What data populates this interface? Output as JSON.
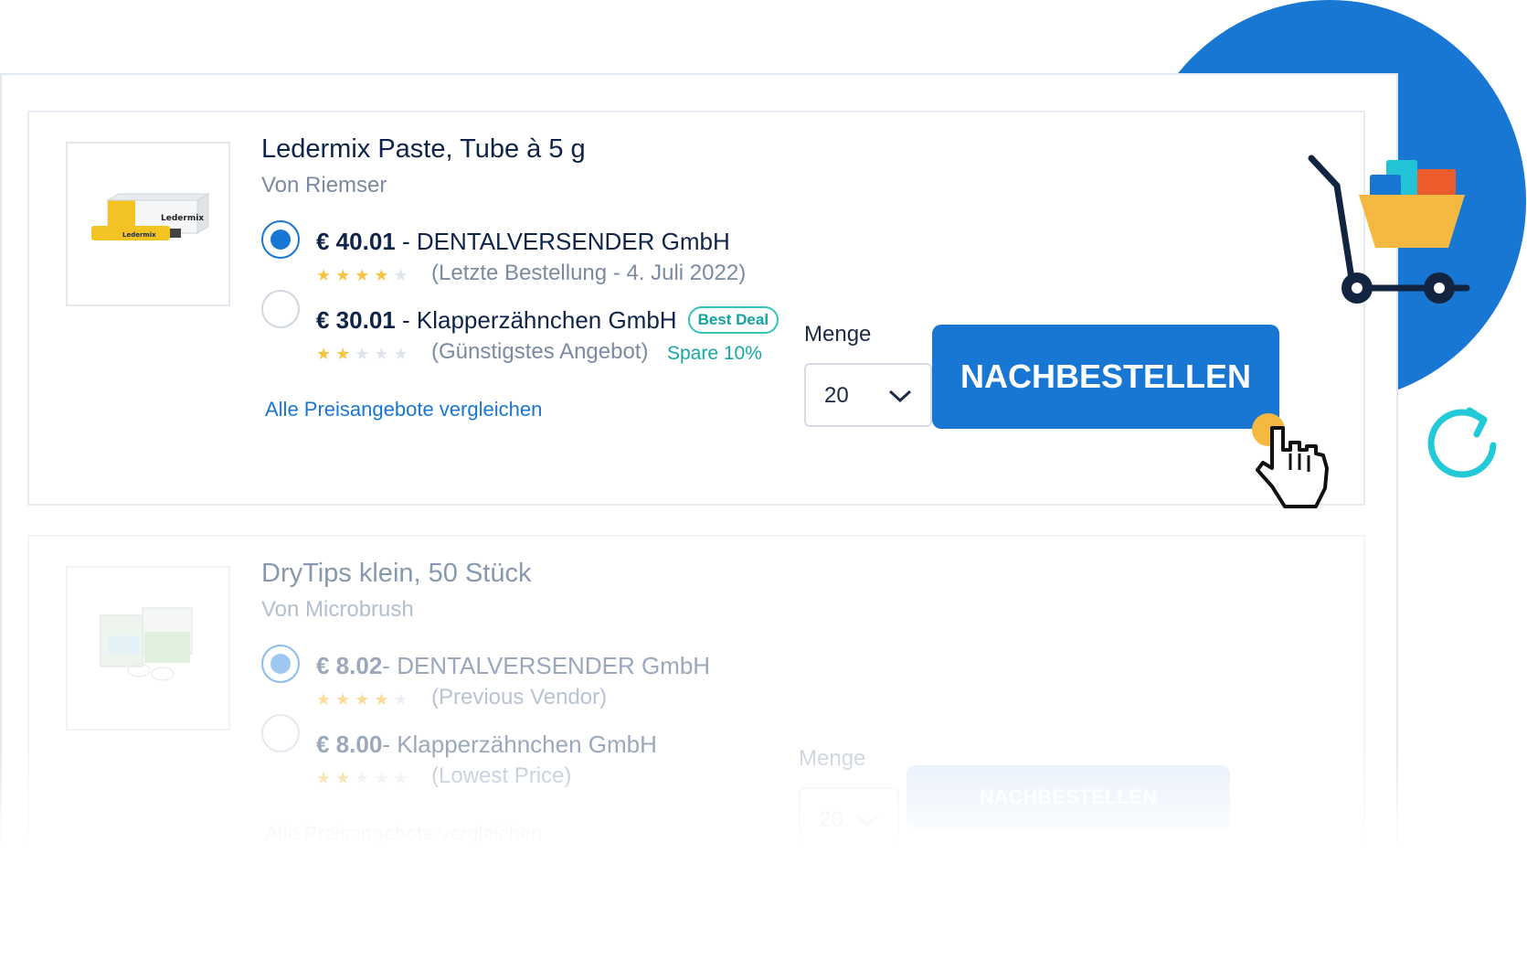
{
  "products": [
    {
      "title": "Ledermix Paste, Tube à 5 g",
      "brand": "Von Riemser",
      "offers": [
        {
          "price": "€ 40.01",
          "separator": " - ",
          "vendor": "DENTALVERSENDER GmbH",
          "rating": 4,
          "note": "(Letzte Bestellung - 4. Juli 2022)",
          "selected": true
        },
        {
          "price": "€ 30.01",
          "separator": " - ",
          "vendor": "Klapperzähnchen GmbH",
          "badge": "Best Deal",
          "rating": 2,
          "note": "(Günstigstes Angebot)",
          "save": "Spare 10%",
          "selected": false
        }
      ],
      "compare_link": "Alle Preisangebote vergleichen",
      "quantity_label": "Menge",
      "quantity": "20",
      "reorder_button": "NACHBESTELLEN"
    },
    {
      "title": "DryTips klein, 50 Stück",
      "brand": "Von Microbrush",
      "offers": [
        {
          "price": "€ 8.02",
          "separator": "- ",
          "vendor": "DENTALVERSENDER GmbH",
          "rating": 4,
          "note": "(Previous Vendor)",
          "selected": true
        },
        {
          "price": "€ 8.00",
          "separator": "- ",
          "vendor": "Klapperzähnchen GmbH",
          "rating": 2,
          "note": "(Lowest Price)",
          "selected": false
        }
      ],
      "compare_link": "Alle Preisangebote vergleichen",
      "quantity_label": "Menge",
      "quantity": "20",
      "reorder_button": "NACHBESTELLEN"
    }
  ],
  "product_image_labels": [
    "Ledermix",
    "Ledermix"
  ],
  "colors": {
    "accent": "#1877d2",
    "teal": "#14a8a4",
    "star": "#f5c542"
  },
  "icons": [
    "cart-icon",
    "refresh-icon",
    "pointer-hand-icon",
    "chevron-down-icon"
  ]
}
